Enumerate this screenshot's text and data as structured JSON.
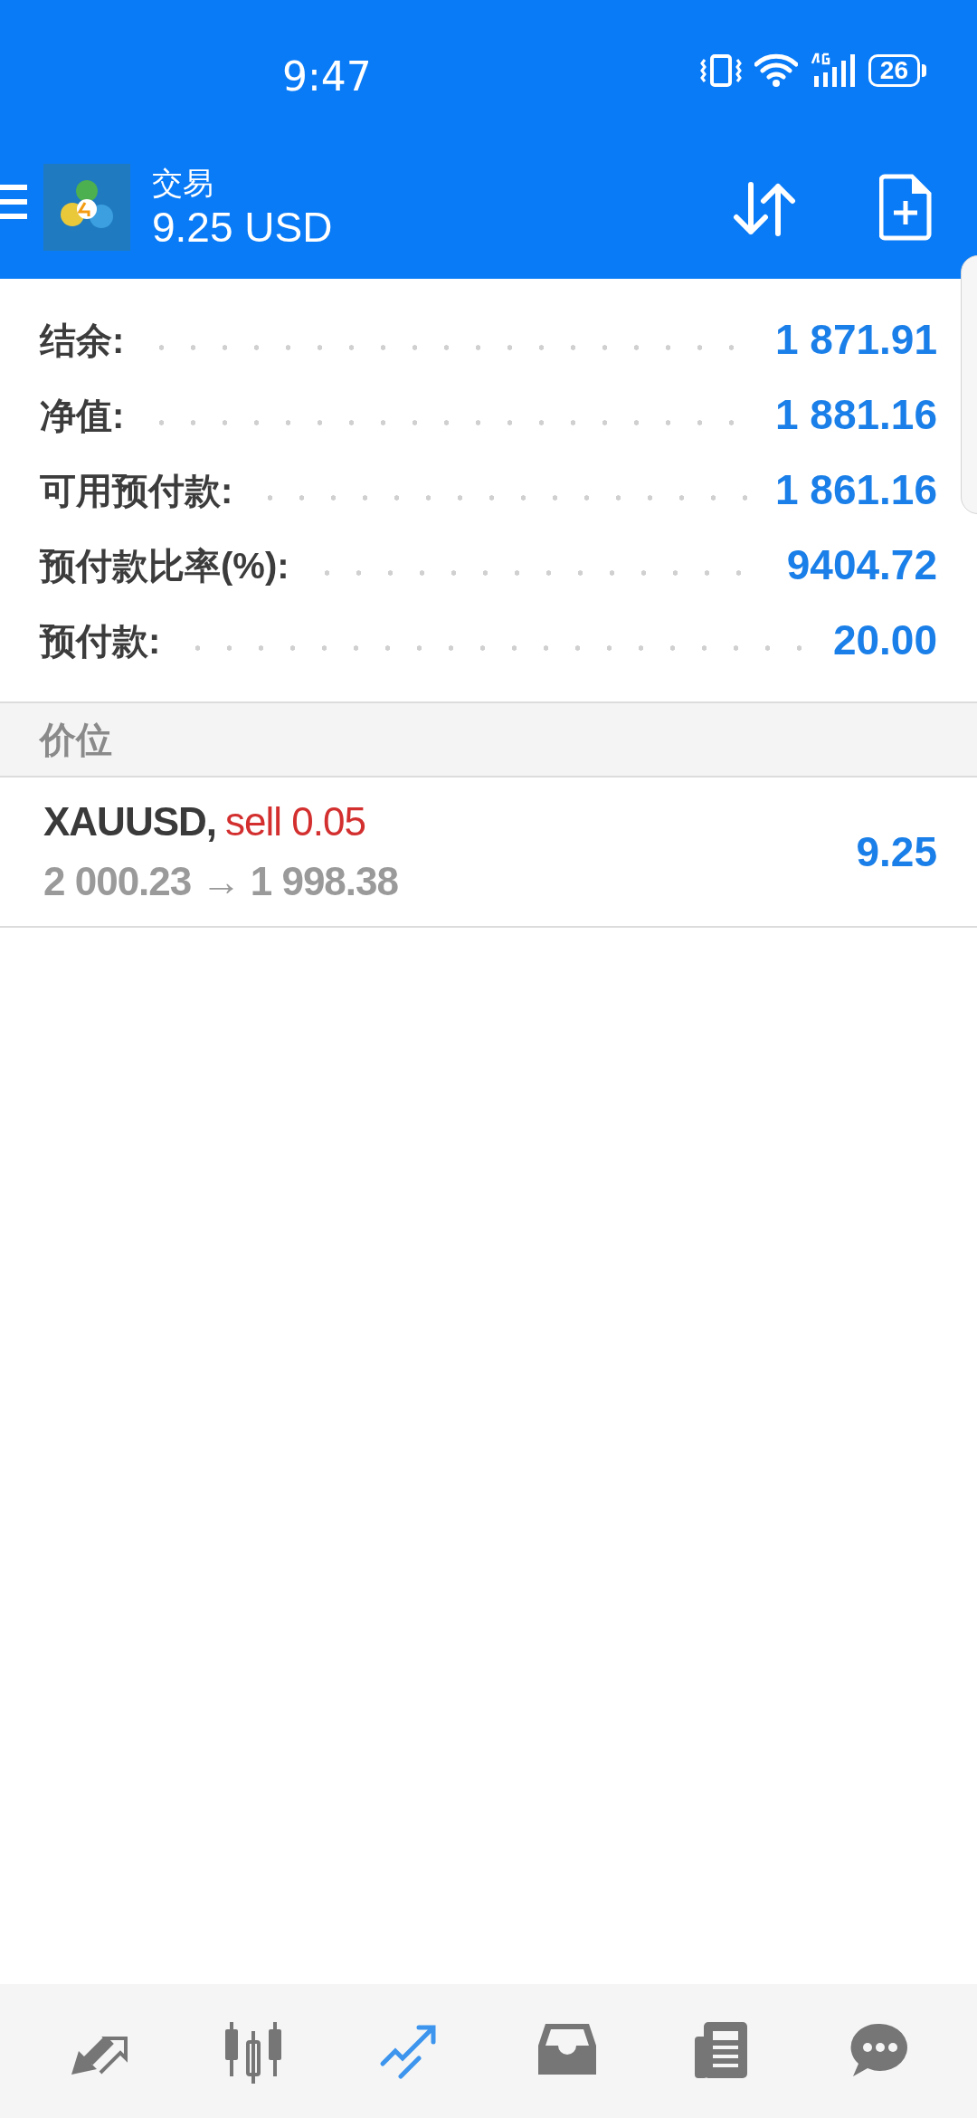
{
  "status_bar": {
    "time": "9:47",
    "battery": "26"
  },
  "header": {
    "title": "交易",
    "subtitle": "9.25 USD"
  },
  "account": [
    {
      "label": "结余:",
      "value": "1 871.91"
    },
    {
      "label": "净值:",
      "value": "1 881.16"
    },
    {
      "label": "可用预付款:",
      "value": "1 861.16"
    },
    {
      "label": "预付款比率(%):",
      "value": "9404.72"
    },
    {
      "label": "预付款:",
      "value": "20.00"
    }
  ],
  "positions_header": "价位",
  "positions": [
    {
      "symbol": "XAUUSD,",
      "side": "sell 0.05",
      "prices": "2 000.23 → 1 998.38",
      "profit": "9.25"
    }
  ],
  "bottom_nav": [
    {
      "kind": "quotes",
      "selected": false
    },
    {
      "kind": "chart",
      "selected": false
    },
    {
      "kind": "trade",
      "selected": true
    },
    {
      "kind": "history",
      "selected": false
    },
    {
      "kind": "news",
      "selected": false
    },
    {
      "kind": "chat",
      "selected": false
    }
  ]
}
